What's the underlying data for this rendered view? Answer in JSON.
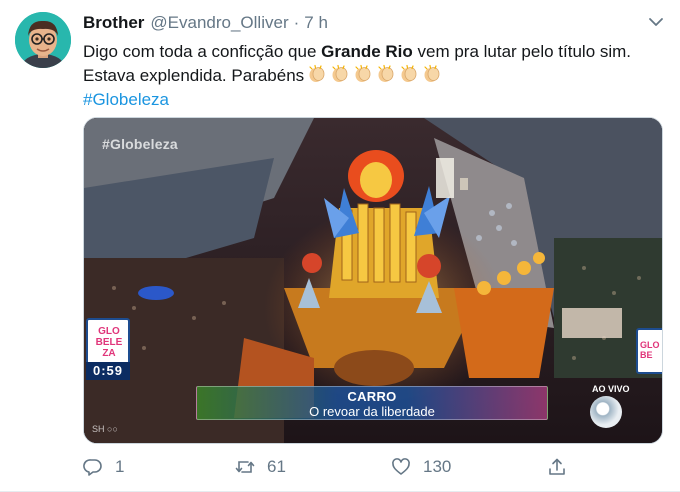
{
  "tweet": {
    "author": {
      "name": "Brother",
      "handle": "@Evandro_Olliver",
      "separator": "·",
      "time": "7 h"
    },
    "text": {
      "line1_a": "Digo com toda a conficção que ",
      "line1_bold": "Grande Rio",
      "line1_b": " vem pra lutar pelo título sim.",
      "line2": "Estava explendida. Parabéns",
      "emoji": "clapping-hands",
      "emoji_count": 6,
      "hashtag": "#Globeleza"
    },
    "media": {
      "watermark": "#Globeleza",
      "side_label_left": "GLO BELE ZA",
      "clock": "0:59",
      "side_label_right": "GLO BE",
      "caption_title": "CARRO",
      "caption_subtitle": "O revoar da liberdade",
      "live_label": "AO VIVO",
      "bottom_left_label": "SH ○○"
    },
    "actions": {
      "reply_count": "1",
      "retweet_count": "61",
      "like_count": "130"
    },
    "colors": {
      "link": "#1b95e0",
      "muted": "#657786",
      "text": "#14171a",
      "avatar_bg": "#28b7ad"
    },
    "icons": [
      "avatar-memoji",
      "chevron-down-icon",
      "clap-icon",
      "reply-icon",
      "retweet-icon",
      "like-icon",
      "share-icon"
    ]
  }
}
